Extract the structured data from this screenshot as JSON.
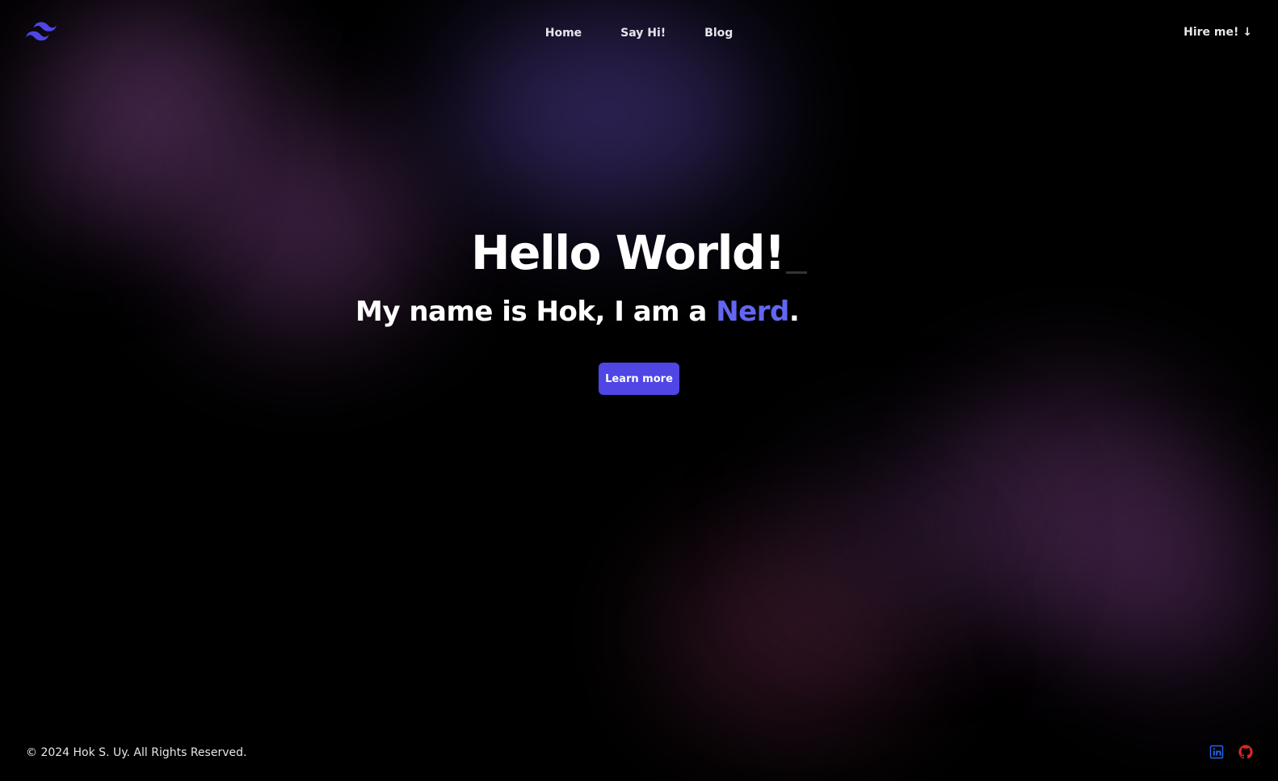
{
  "header": {
    "logo_icon": "tailwind-wave-icon",
    "nav": [
      {
        "label": "Home"
      },
      {
        "label": "Say Hi!"
      },
      {
        "label": "Blog"
      }
    ],
    "hire_label": "Hire me! ↓"
  },
  "hero": {
    "title": "Hello World!",
    "subtitle_prefix": "My name is Hok, I am a ",
    "subtitle_accent": "Nerd",
    "subtitle_suffix": ".",
    "button_label": "Learn more"
  },
  "footer": {
    "copyright": "© 2024 Hok S. Uy. All Rights Reserved.",
    "social": [
      {
        "icon": "linkedin-icon"
      },
      {
        "icon": "github-icon"
      }
    ]
  },
  "colors": {
    "accent": "#6366f1",
    "button": "#4f46e5",
    "linkedin": "#2563eb",
    "github": "#dc2626"
  }
}
